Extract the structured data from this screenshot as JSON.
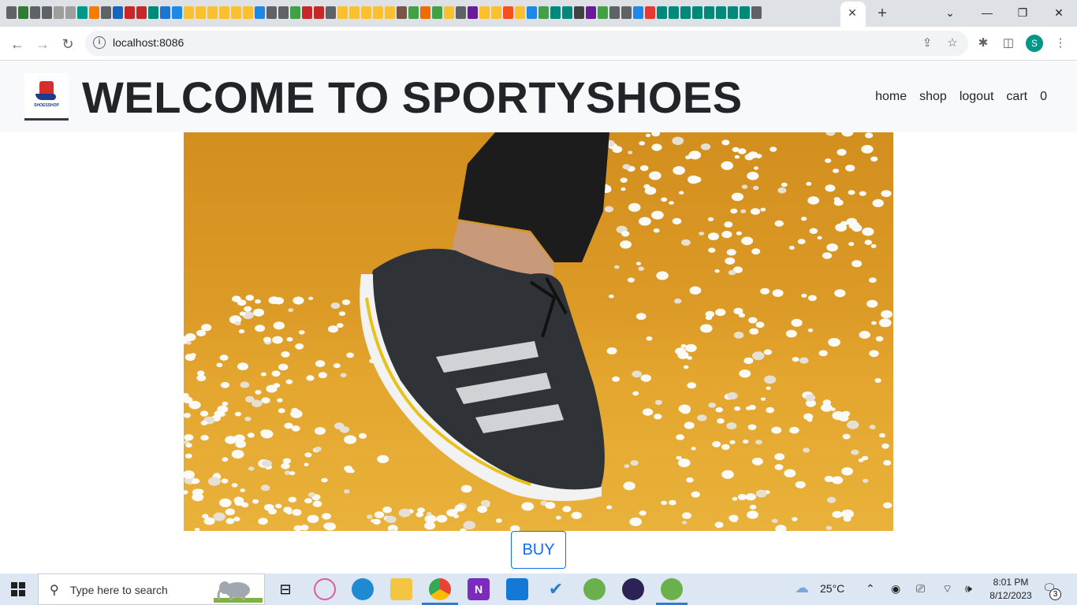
{
  "browser": {
    "url": "localhost:8086",
    "tab_close": "✕",
    "new_tab": "+",
    "win_controls": [
      "⌄",
      "—",
      "❐",
      "✕"
    ],
    "profile_initial": "S",
    "tab_icon_colors": [
      "#5f6368",
      "#2e7d32",
      "#5f6368",
      "#5f6368",
      "#9e9e9e",
      "#9e9e9e",
      "#009688",
      "#f57c00",
      "#5f6368",
      "#1565c0",
      "#c62828",
      "#c62828",
      "#00897b",
      "#1976d2",
      "#1e88e5",
      "#fbc02d",
      "#fbc02d",
      "#fbc02d",
      "#fbc02d",
      "#fbc02d",
      "#fbc02d",
      "#1e88e5",
      "#5f6368",
      "#5f6368",
      "#43a047",
      "#c62828",
      "#c62828",
      "#5f6368",
      "#fbc02d",
      "#fbc02d",
      "#fbc02d",
      "#fbc02d",
      "#fbc02d",
      "#795548",
      "#43a047",
      "#ef6c00",
      "#43a047",
      "#fbc02d",
      "#5f6368",
      "#6a1b9a",
      "#fbc02d",
      "#fbc02d",
      "#f4511e",
      "#fbc02d",
      "#1e88e5",
      "#43a047",
      "#00897b",
      "#00897b",
      "#424242",
      "#6a1b9a",
      "#43a047",
      "#5f6368",
      "#5f6368",
      "#1e88e5",
      "#e53935",
      "#00897b",
      "#00897b",
      "#00897b",
      "#00897b",
      "#00897b",
      "#00897b",
      "#00897b",
      "#00897b",
      "#5f6368"
    ]
  },
  "navbar": {
    "title": "WELCOME TO SPORTYSHOES",
    "logo_text": "SHOESSHOP",
    "links": [
      "home",
      "shop",
      "logout",
      "cart",
      "0"
    ]
  },
  "hero": {
    "buy_label": "BUY"
  },
  "taskbar": {
    "search_placeholder": "Type here to search",
    "weather": "25°C",
    "time": "8:01 PM",
    "date": "8/12/2023",
    "notification_count": "3"
  }
}
